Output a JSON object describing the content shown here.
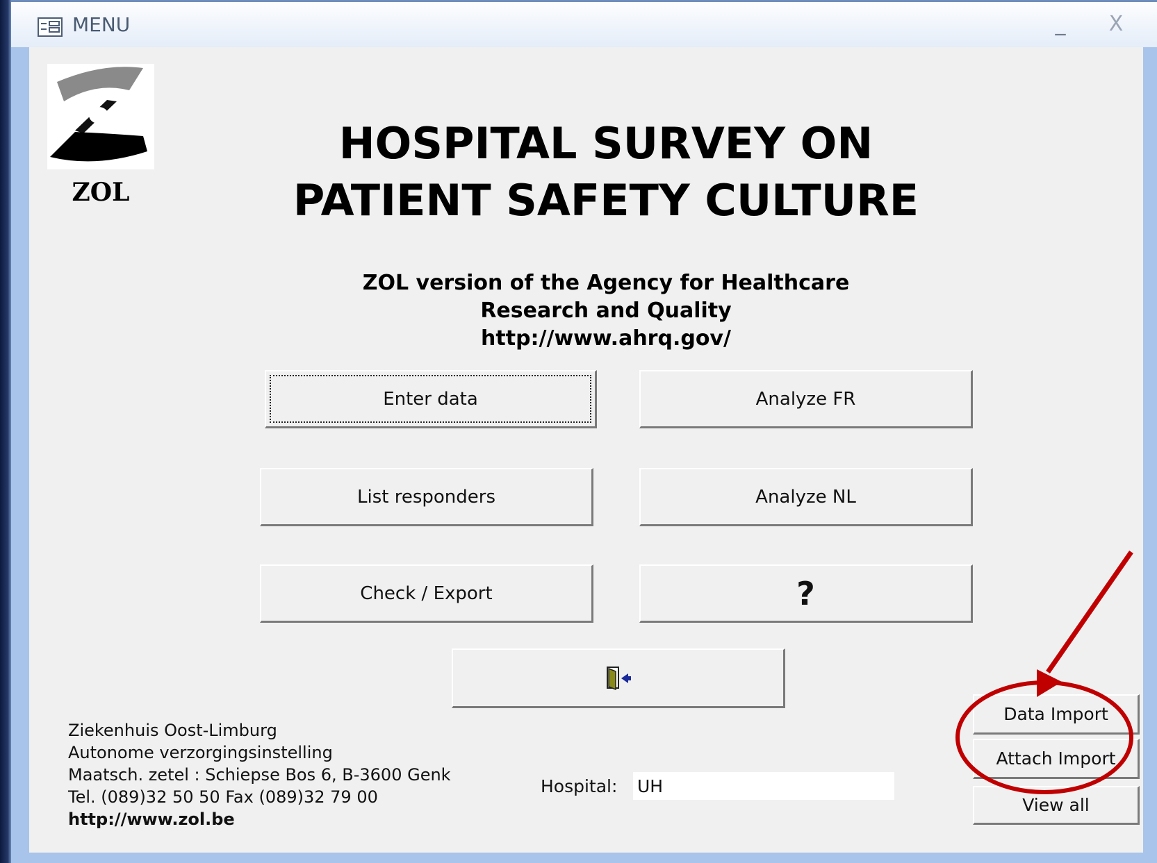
{
  "window": {
    "title": "MENU",
    "minimize_glyph": "_",
    "close_glyph": "X"
  },
  "logo": {
    "text": "ZOL"
  },
  "header": {
    "line1": "HOSPITAL SURVEY ON",
    "line2": "PATIENT SAFETY CULTURE"
  },
  "subheader": {
    "line1": "ZOL version of the Agency for Healthcare",
    "line2": "Research and Quality",
    "line3": "http://www.ahrq.gov/"
  },
  "buttons": {
    "enter_data": "Enter data",
    "analyze_fr": "Analyze FR",
    "list_responders": "List responders",
    "analyze_nl": "Analyze NL",
    "check_export": "Check / Export",
    "help": "?",
    "exit_icon": "exit-door-icon",
    "data_import": "Data Import",
    "attach_import": "Attach Import",
    "view_all": "View all"
  },
  "footer": {
    "line1": "Ziekenhuis Oost-Limburg",
    "line2": "Autonome verzorgingsinstelling",
    "line3": "Maatsch. zetel : Schiepse Bos 6, B-3600 Genk",
    "line4": "Tel. (089)32 50 50 Fax (089)32 79 00",
    "url": "http://www.zol.be"
  },
  "hospital": {
    "label": "Hospital:",
    "value": "UH"
  },
  "colors": {
    "annotation": "#c00000",
    "form_background": "#f0f0f0",
    "window_frame": "#a9c4ea"
  }
}
